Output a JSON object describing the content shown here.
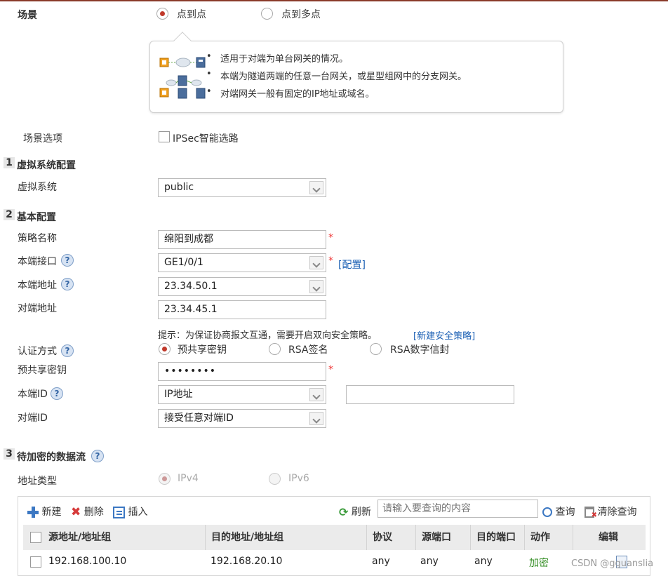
{
  "scenario": {
    "label": "场景",
    "option_p2p": "点到点",
    "option_p2mp": "点到多点",
    "tips": [
      "适用于对端为单台网关的情况。",
      "本端为隧道两端的任意一台网关，或星型组网中的分支网关。",
      "对端网关一般有固定的IP地址或域名。"
    ],
    "options_label": "场景选项",
    "ipsec_smart_route": "IPSec智能选路"
  },
  "section1": {
    "num": "1",
    "title": "虚拟系统配置",
    "vsys_label": "虚拟系统",
    "vsys_value": "public"
  },
  "section2": {
    "num": "2",
    "title": "基本配置",
    "policy_name_label": "策略名称",
    "policy_name_value": "绵阳到成都",
    "local_if_label": "本端接口",
    "local_if_value": "GE1/0/1",
    "config_link": "[配置]",
    "local_addr_label": "本端地址",
    "local_addr_value": "23.34.50.1",
    "peer_addr_label": "对端地址",
    "peer_addr_value": "23.34.45.1",
    "hint": "提示：为保证协商报文互通，需要开启双向安全策略。",
    "hint_link": "[新建安全策略]",
    "auth_label": "认证方式",
    "auth_psk": "预共享密钥",
    "auth_rsa_sig": "RSA签名",
    "auth_rsa_env": "RSA数字信封",
    "psk_label": "预共享密钥",
    "psk_value": "••••••••",
    "local_id_label": "本端ID",
    "local_id_value": "IP地址",
    "peer_id_label": "对端ID",
    "peer_id_value": "接受任意对端ID",
    "required_mark": "*"
  },
  "section3": {
    "num": "3",
    "title": "待加密的数据流",
    "addr_type_label": "地址类型",
    "ipv4": "IPv4",
    "ipv6": "IPv6",
    "toolbar": {
      "new": "新建",
      "delete": "删除",
      "insert": "插入",
      "refresh": "刷新",
      "search_placeholder": "请输入要查询的内容",
      "query": "查询",
      "clear_query": "清除查询"
    },
    "columns": [
      "源地址/地址组",
      "目的地址/地址组",
      "协议",
      "源端口",
      "目的端口",
      "动作",
      "编辑"
    ],
    "rows": [
      [
        "192.168.100.10",
        "192.168.20.10",
        "any",
        "any",
        "any",
        "加密",
        ""
      ]
    ]
  },
  "help_glyph": "?",
  "watermark": "CSDN @gguanslia",
  "colors": {
    "radio_selected": "#c0392b",
    "link": "#1a5fb4",
    "required": "#e33333",
    "encrypt_action": "#2e8b1e"
  }
}
